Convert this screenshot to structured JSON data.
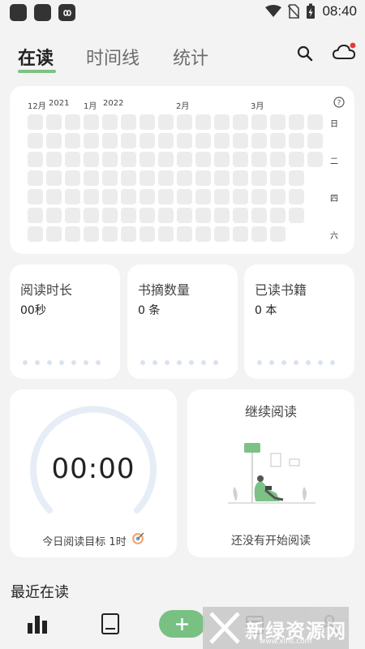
{
  "status_bar": {
    "time": "08:40",
    "icons": [
      "wifi-icon",
      "no-sim-icon",
      "battery-charging-icon"
    ],
    "app_icons": [
      "app-icon",
      "app-icon",
      "infinity-icon"
    ]
  },
  "tabs": [
    {
      "label": "在读",
      "active": true
    },
    {
      "label": "时间线",
      "active": false
    },
    {
      "label": "统计",
      "active": false
    }
  ],
  "header_icons": [
    "search-icon",
    "cloud-icon"
  ],
  "heatmap": {
    "month_labels": [
      "12月",
      "2021",
      "1月",
      "2022",
      "2月",
      "3月"
    ],
    "day_labels": [
      "日",
      "二",
      "四",
      "六"
    ],
    "help_icon": "question-icon"
  },
  "stats": [
    {
      "title": "阅读时长",
      "value": "00秒"
    },
    {
      "title": "书摘数量",
      "value": "0 条"
    },
    {
      "title": "已读书籍",
      "value": "0 本"
    }
  ],
  "timer": {
    "display": "00:00",
    "goal_label": "今日阅读目标 1时",
    "goal_icon": "target-icon"
  },
  "continue_reading": {
    "title": "继续阅读",
    "empty_text": "还没有开始阅读"
  },
  "recent": {
    "title": "最近在读"
  },
  "bottom_nav": [
    "stats-icon",
    "book-icon",
    "add-icon",
    "calendar-icon",
    "profile-icon"
  ],
  "watermark": {
    "text": "新绿资源网",
    "url": "www.xlhs.com"
  },
  "colors": {
    "accent": "#78c182",
    "card": "#ffffff",
    "background": "#f3f3f3",
    "heat_cell": "#ececec",
    "notification_dot": "#e53935"
  }
}
